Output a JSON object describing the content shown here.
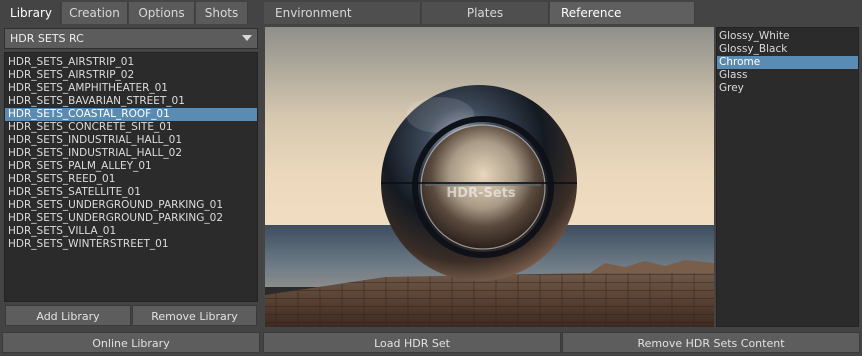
{
  "left_tabs": [
    "Library",
    "Creation",
    "Options",
    "Shots"
  ],
  "right_tabs": [
    "Environment",
    "Plates",
    "Reference"
  ],
  "library_dropdown": {
    "selected": "HDR SETS RC"
  },
  "hdr_sets": [
    "HDR_SETS_AIRSTRIP_01",
    "HDR_SETS_AIRSTRIP_02",
    "HDR_SETS_AMPHITHEATER_01",
    "HDR_SETS_BAVARIAN_STREET_01",
    "HDR_SETS_COASTAL_ROOF_01",
    "HDR_SETS_CONCRETE_SITE_01",
    "HDR_SETS_INDUSTRIAL_HALL_01",
    "HDR_SETS_INDUSTRIAL_HALL_02",
    "HDR_SETS_PALM_ALLEY_01",
    "HDR_SETS_REED_01",
    "HDR_SETS_SATELLITE_01",
    "HDR_SETS_UNDERGROUND_PARKING_01",
    "HDR_SETS_UNDERGROUND_PARKING_02",
    "HDR_SETS_VILLA_01",
    "HDR_SETS_WINTERSTREET_01"
  ],
  "selected_set": "HDR_SETS_COASTAL_ROOF_01",
  "buttons": {
    "add_library": "Add Library",
    "remove_library": "Remove Library",
    "online_library": "Online Library",
    "load_hdr_set": "Load HDR Set",
    "remove_content": "Remove HDR Sets Content"
  },
  "shaders": [
    "Glossy_White",
    "Glossy_Black",
    "Chrome",
    "Glass",
    "Grey"
  ],
  "selected_shader": "Chrome",
  "preview": {
    "watermark": "HDR-Sets"
  },
  "colors": {
    "selection": "#5a8bb3",
    "panel_bg": "#444444",
    "list_bg": "#2b2b2b"
  }
}
